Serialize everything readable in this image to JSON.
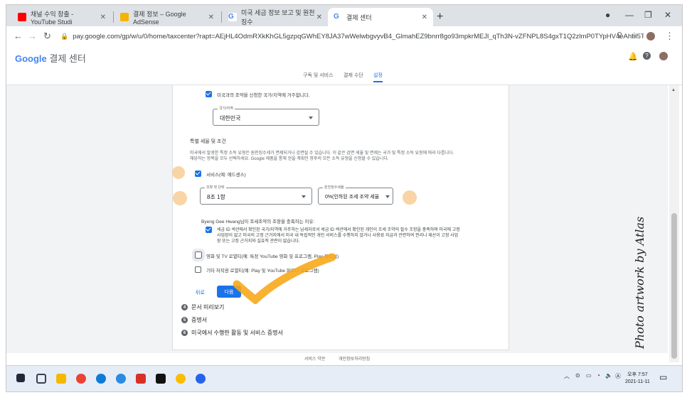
{
  "browser": {
    "tabs": [
      {
        "label": "채널 수익 창출 - YouTube Studi",
        "close": "✕",
        "icon_color": "#ff0000"
      },
      {
        "label": "결제 정보 – Google AdSense",
        "close": "✕",
        "icon_color": "#f4b400"
      },
      {
        "label": "미국 세금 정보 보고 및 원천징수",
        "close": "✕",
        "icon_color": "#4285f4"
      },
      {
        "label": "결제 센터",
        "close": "✕",
        "icon_color": "#4285f4"
      }
    ],
    "new_tab": "+",
    "url": "pay.google.com/gp/w/u/0/home/taxcenter?rapt=AEjHL4OdmRXkKhGL5gzpqGWhEY8JA37wWelwbgvyvB4_GlmahEZ9bnrr8go93mpkrMEJl_qTh3N-vZFNPL8S4gxT1Q2zlmP0TYpHV4eAhbi5Tfe-NB2h1..."
  },
  "header": {
    "logo_brand": "Google",
    "logo_product": " 결제 센터"
  },
  "subnav": {
    "items": [
      "구독 및 서비스",
      "결제 수단",
      "설정"
    ]
  },
  "form": {
    "residence_checkbox": "미국과의 조약을 신청한 국가/지역에 거주합니다.",
    "country_legend": "국가/지역",
    "country_value": "대한민국",
    "special_title": "특별 세율 및 조건",
    "special_desc_1": "미국에서 발생한 특정 소득 유형은 원천징수세가 면제되거나 감면될 수 있습니다. 이 같은 감면 세율 및 면제는 국가 및 특정 소득 유형에 따라 다릅니다.",
    "special_desc_2": "해당하는 항목을 모두 선택하세요. Google 제품을 통해 얻을 계획인 향후의 모든 소득 유형을 신청할 수 있습니다.",
    "services_checkbox": "서비스(예: 애드센스)",
    "article_legend": "조항 및 단락",
    "article_value": "8조 1항",
    "rate_legend": "원천징수세율",
    "rate_value": "0%(인하된 조세 조약 세율",
    "reason_label": "Byeng Gee Hwang님이 조세조약의 조항을 충족하는 이유:",
    "reason_text_1": "세금 ID 섹션에서 확인된 국가/지역에 거주하는 납세자로서 세금 ID 섹션에서 확인된 개인이 조세 조약의 필수 조항을 충족하며 미국에 고정",
    "reason_text_2": "사업장이 없고 미국의 고정 근거지에서 미국 내 독립적인 개인 서비스를 수행하지 않거나 사용료 지급과 관련하여 권리나 재산이 고정 사업",
    "reason_text_3": "장 또는 고정 근거지와 실효적 관련이 없습니다.",
    "movies_checkbox": "영화 및 TV 로열티(예: 특정 YouTube 영화 및 프로그램, Play 파트너)",
    "other_checkbox": "기타 저작권 로열티(예: Play 및 YouTube 파트너 프로그램)",
    "back_label": "뒤로",
    "next_label": "다음"
  },
  "steps": [
    {
      "num": "4",
      "label": "문서 미리보기"
    },
    {
      "num": "5",
      "label": "증명서"
    },
    {
      "num": "6",
      "label": "미국에서 수행한 활동 및 서비스 증명서"
    }
  ],
  "footer": {
    "terms": "서비스 약관",
    "privacy": "개인정보처리방침"
  },
  "taskbar": {
    "time": "오후 7:57",
    "date": "2021-11-11"
  },
  "watermark": "Photo artwork by Atlas"
}
